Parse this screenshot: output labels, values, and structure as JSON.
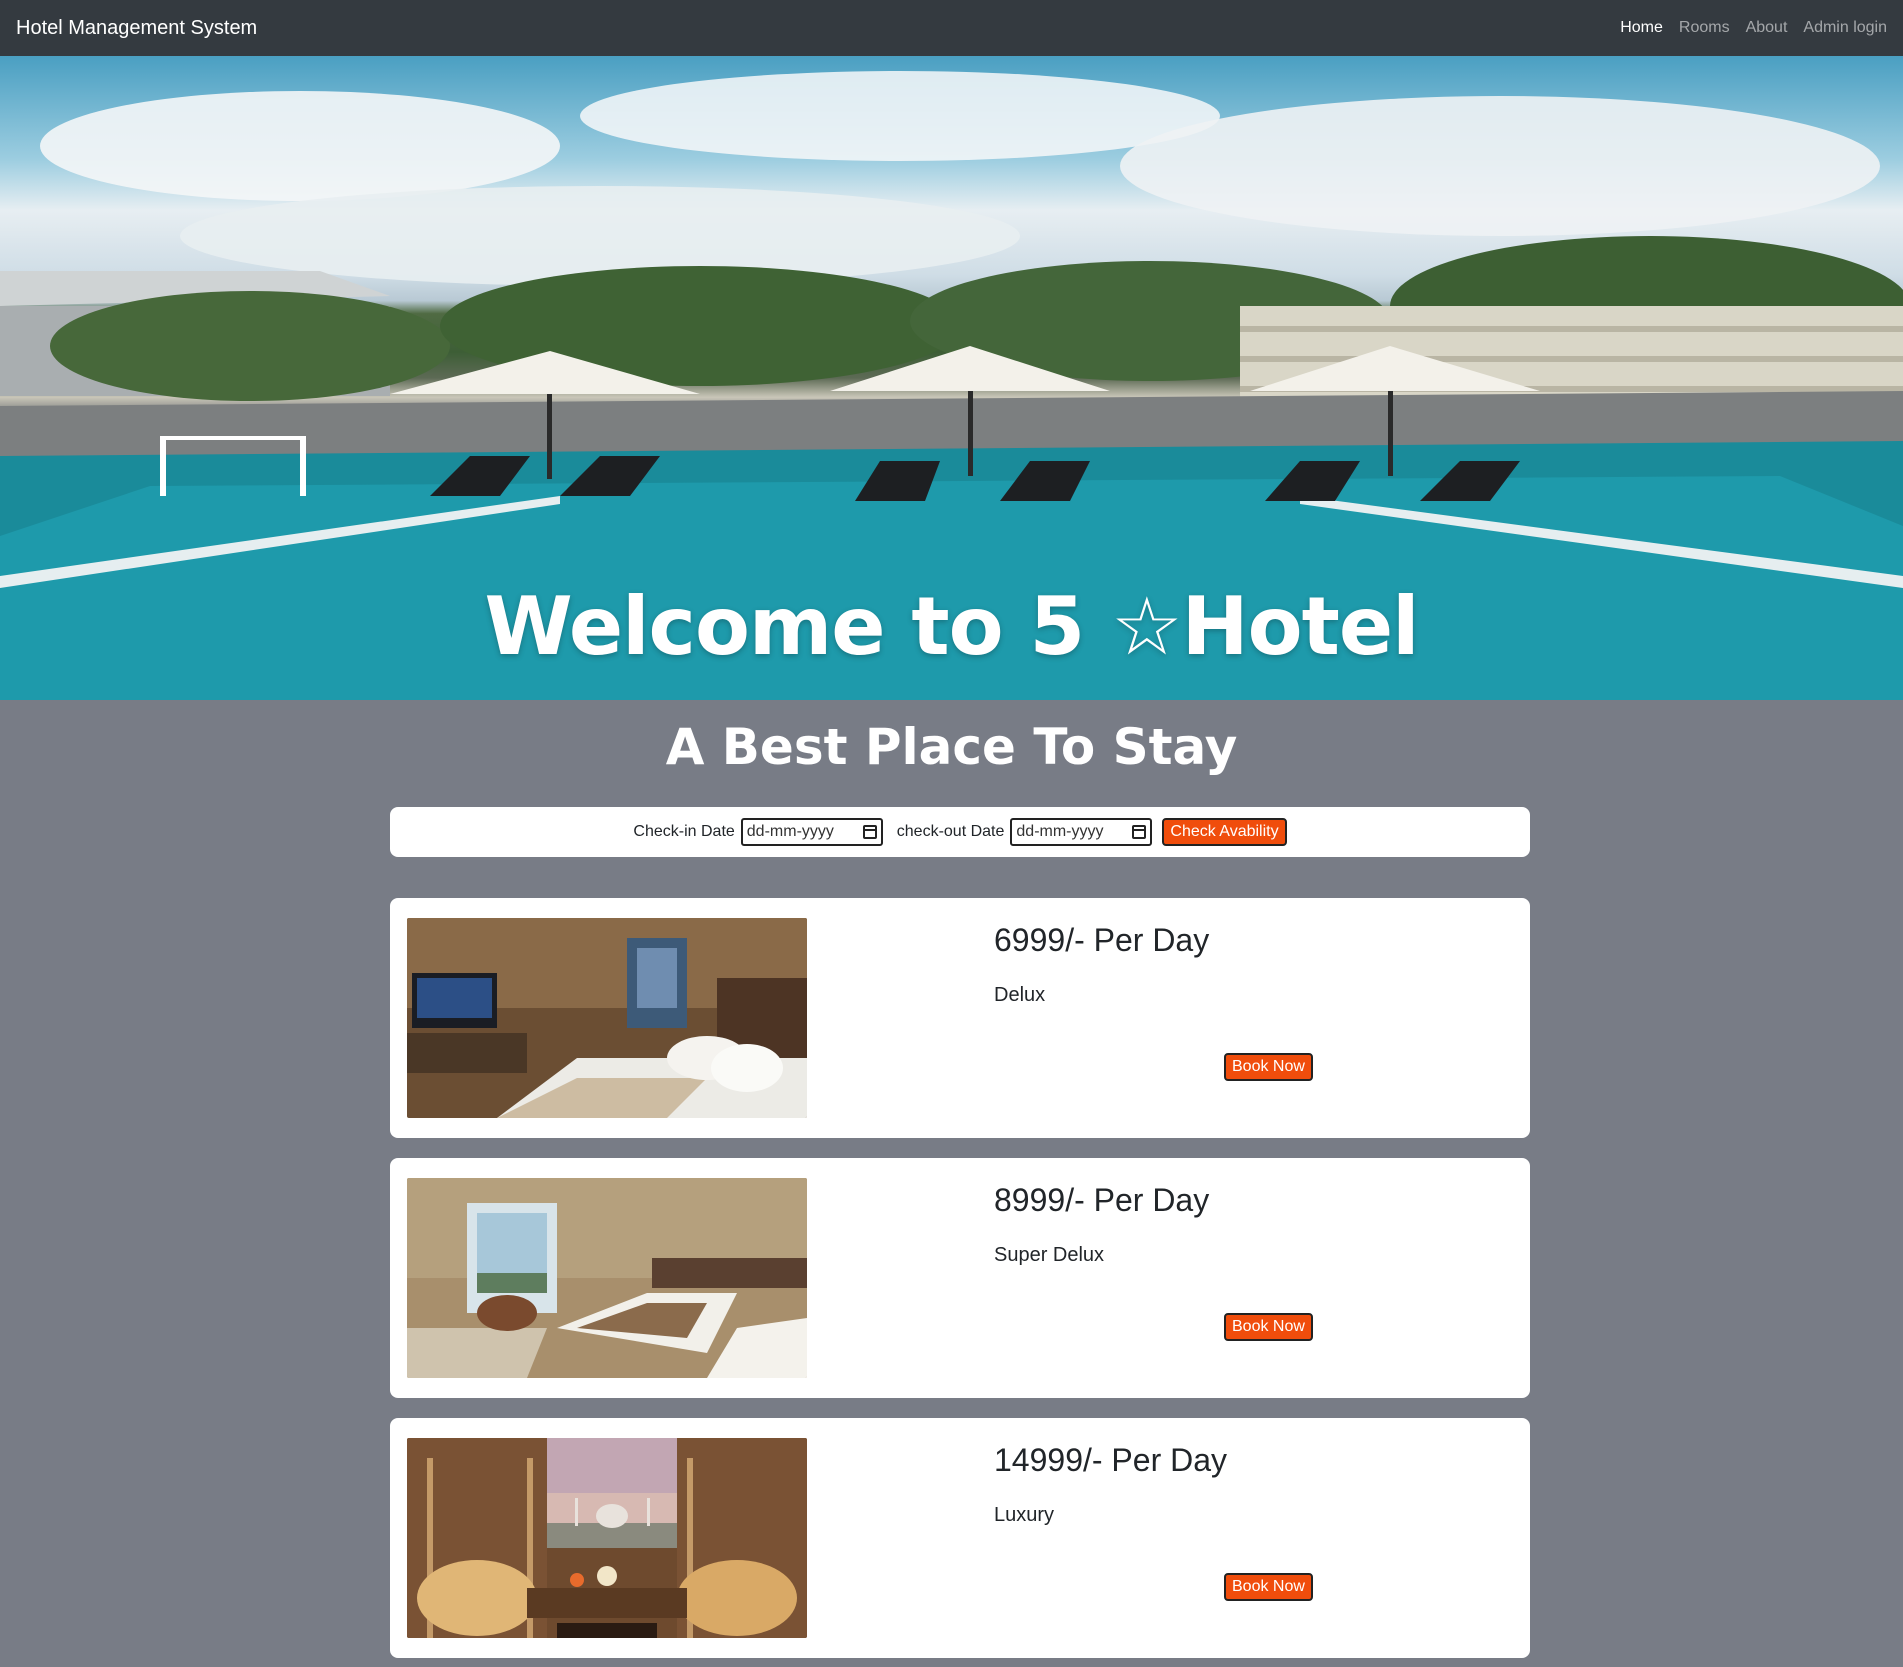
{
  "nav": {
    "brand": "Hotel Management System",
    "links": [
      {
        "label": "Home",
        "active": true
      },
      {
        "label": "Rooms",
        "active": false
      },
      {
        "label": "About",
        "active": false
      },
      {
        "label": "Admin login",
        "active": false
      }
    ]
  },
  "hero": {
    "title": "Welcome to 5 ☆Hotel"
  },
  "subtitle": "A Best Place To Stay",
  "search": {
    "checkin_label": "Check-in Date",
    "checkin_placeholder": "dd-mm-yyyy",
    "checkout_label": "check-out Date",
    "checkout_placeholder": "dd-mm-yyyy",
    "button_label": "Check Avability"
  },
  "rooms": [
    {
      "price": "6999/- Per Day",
      "type": "Delux",
      "button": "Book Now"
    },
    {
      "price": "8999/- Per Day",
      "type": "Super Delux",
      "button": "Book Now"
    },
    {
      "price": "14999/- Per Day",
      "type": "Luxury",
      "button": "Book Now"
    }
  ],
  "colors": {
    "navbar": "#343a40",
    "page_background": "#787c86",
    "accent_button": "#f04d0c"
  }
}
